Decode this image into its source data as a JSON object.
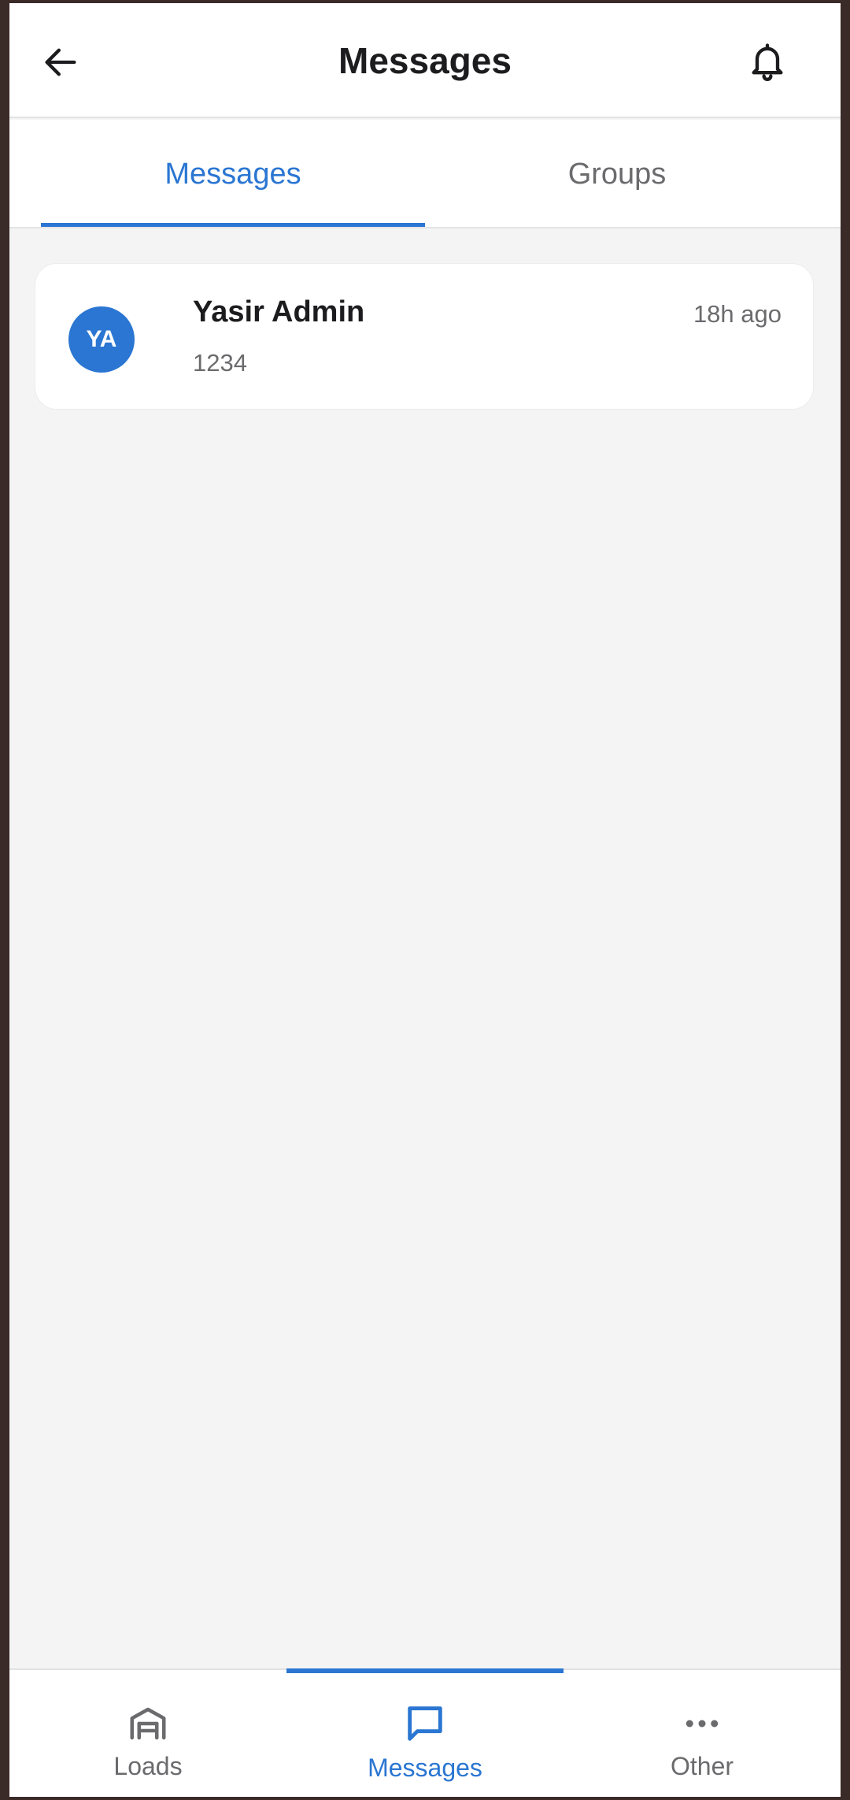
{
  "header": {
    "title": "Messages",
    "back_icon": "arrow-left-icon",
    "notification_icon": "bell-icon"
  },
  "tabs": [
    {
      "label": "Messages",
      "active": true
    },
    {
      "label": "Groups",
      "active": false
    }
  ],
  "conversations": [
    {
      "avatar_initials": "YA",
      "name": "Yasir Admin",
      "last_message": "1234",
      "time": "18h ago"
    }
  ],
  "bottom_nav": {
    "items": [
      {
        "label": "Loads",
        "icon": "warehouse-icon",
        "active": false
      },
      {
        "label": "Messages",
        "icon": "chat-bubble-icon",
        "active": true
      },
      {
        "label": "Other",
        "icon": "more-horizontal-icon",
        "active": false
      }
    ]
  },
  "colors": {
    "accent": "#2a76d2",
    "text_primary": "#1c1c1e",
    "text_secondary": "#6b6b6e",
    "background": "#f4f4f5",
    "surface": "#ffffff"
  }
}
